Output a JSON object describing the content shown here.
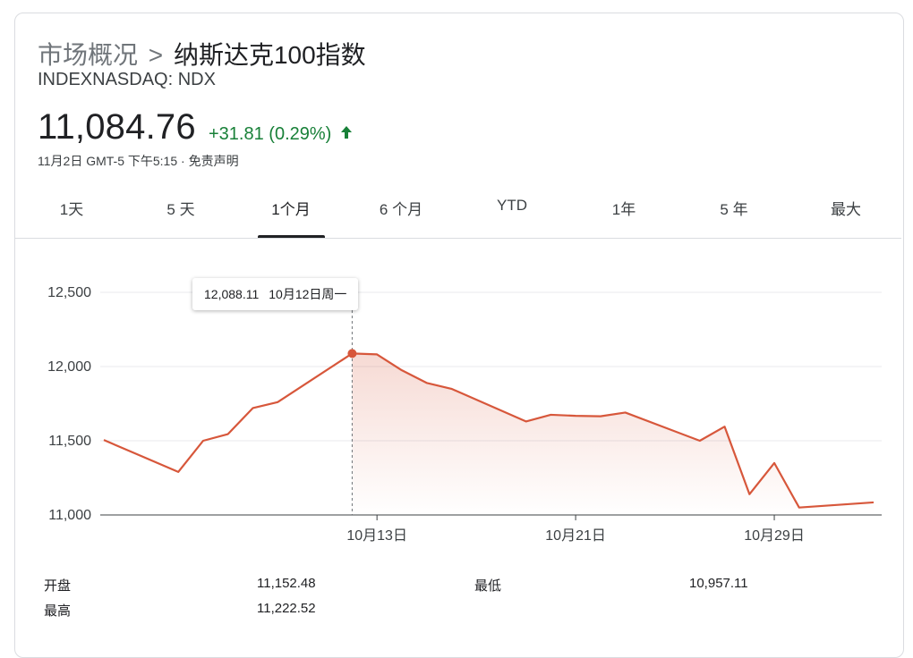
{
  "breadcrumb": {
    "parent": "市场概况",
    "separator": ">",
    "current": "纳斯达克100指数"
  },
  "ticker": "INDEXNASDAQ: NDX",
  "price": "11,084.76",
  "change": "+31.81 (0.29%)",
  "timestamp": "11月2日 GMT-5 下午5:15 · 免责声明",
  "tabs": [
    "1天",
    "5 天",
    "1个月",
    "6 个月",
    "YTD",
    "1年",
    "5 年",
    "最大"
  ],
  "active_tab": "1个月",
  "colors": {
    "line": "#d7573b",
    "positive": "#188038",
    "grid": "#e8eaed"
  },
  "tooltip": {
    "value": "12,088.11",
    "date": "10月12日周一"
  },
  "chart_data": {
    "type": "area",
    "title": "",
    "xlabel": "",
    "ylabel": "",
    "ylim": [
      11000,
      12500
    ],
    "yticks": [
      11000,
      11500,
      12000,
      12500
    ],
    "ytick_labels": [
      "11,000",
      "11,500",
      "12,000",
      "12,500"
    ],
    "xtick_labels": [
      {
        "label": "10月13日",
        "date": "2020-10-13"
      },
      {
        "label": "10月21日",
        "date": "2020-10-21"
      },
      {
        "label": "10月29日",
        "date": "2020-10-29"
      }
    ],
    "series": [
      {
        "x": [
          "2020-10-02",
          "2020-10-05",
          "2020-10-06",
          "2020-10-07",
          "2020-10-08",
          "2020-10-09",
          "2020-10-12",
          "2020-10-13",
          "2020-10-14",
          "2020-10-15",
          "2020-10-16",
          "2020-10-19",
          "2020-10-20",
          "2020-10-21",
          "2020-10-22",
          "2020-10-23",
          "2020-10-26",
          "2020-10-27",
          "2020-10-28",
          "2020-10-29",
          "2020-10-30",
          "2020-11-02"
        ],
        "values": [
          11505,
          11290,
          11500,
          11545,
          11720,
          11760,
          12088.11,
          12082,
          11975,
          11890,
          11850,
          11630,
          11675,
          11668,
          11665,
          11690,
          11500,
          11595,
          11140,
          11350,
          11050,
          11084.76
        ],
        "highlight_index": 6
      }
    ],
    "grid": true,
    "legend": "none"
  },
  "stats": [
    {
      "label": "开盘",
      "value": "11,152.48"
    },
    {
      "label": "最低",
      "value": "10,957.11"
    },
    {
      "label": "最高",
      "value": "11,222.52"
    }
  ]
}
